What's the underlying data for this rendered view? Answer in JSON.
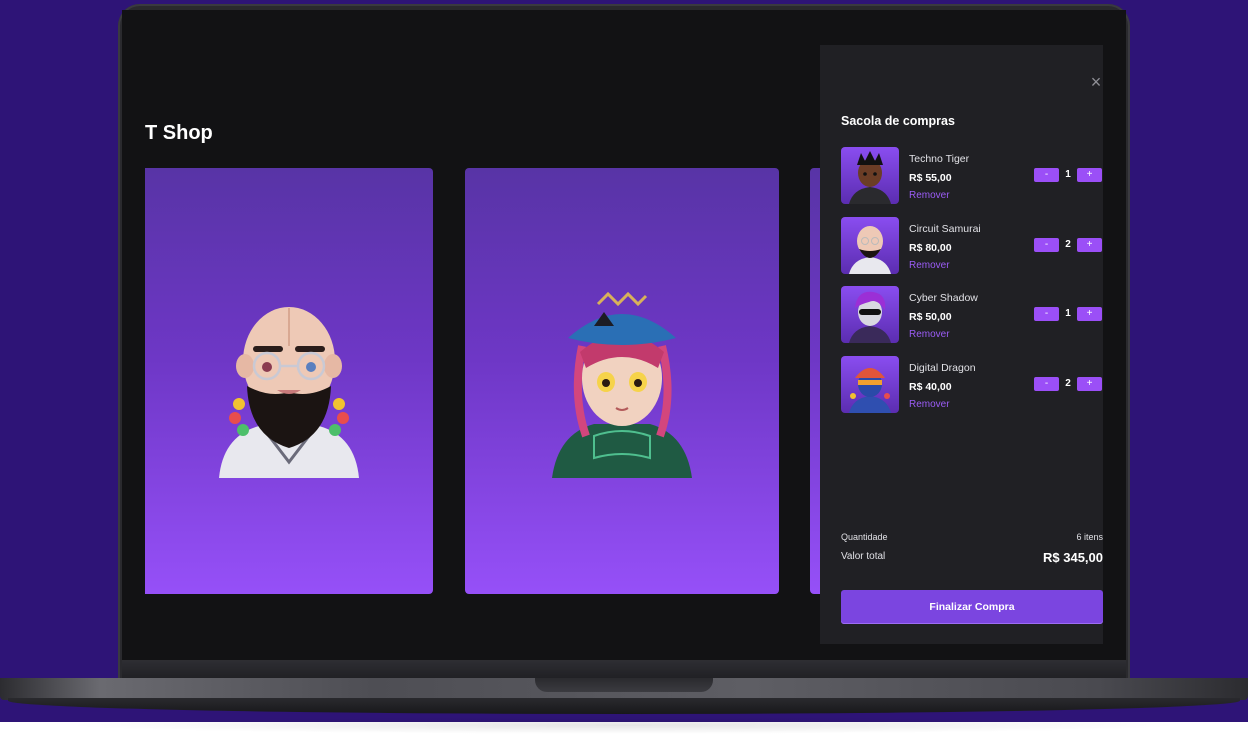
{
  "shop": {
    "title": "T Shop"
  },
  "cart": {
    "title": "Sacola de compras",
    "items": [
      {
        "name": "Techno Tiger",
        "price": "R$ 55,00",
        "quantity": "1",
        "remove_label": "Remover"
      },
      {
        "name": "Circuit Samurai",
        "price": "R$ 80,00",
        "quantity": "2",
        "remove_label": "Remover"
      },
      {
        "name": "Cyber Shadow",
        "price": "R$ 50,00",
        "quantity": "1",
        "remove_label": "Remover"
      },
      {
        "name": "Digital Dragon",
        "price": "R$ 40,00",
        "quantity": "2",
        "remove_label": "Remover"
      }
    ],
    "qty_minus_label": "-",
    "qty_plus_label": "+",
    "summary": {
      "quantity_label": "Quantidade",
      "quantity_value": "6 itens",
      "total_label": "Valor total",
      "total_value": "R$ 345,00"
    },
    "checkout_label": "Finalizar Compra",
    "close_icon": "close-icon"
  },
  "colors": {
    "page_background": "#2e1477",
    "screen_background": "#121214",
    "panel_background": "#202024",
    "accent": "#9b4ff7",
    "checkout_button": "#7b45e0",
    "card_gradient_top": "#5834a6",
    "card_gradient_bottom": "#9650f8"
  }
}
